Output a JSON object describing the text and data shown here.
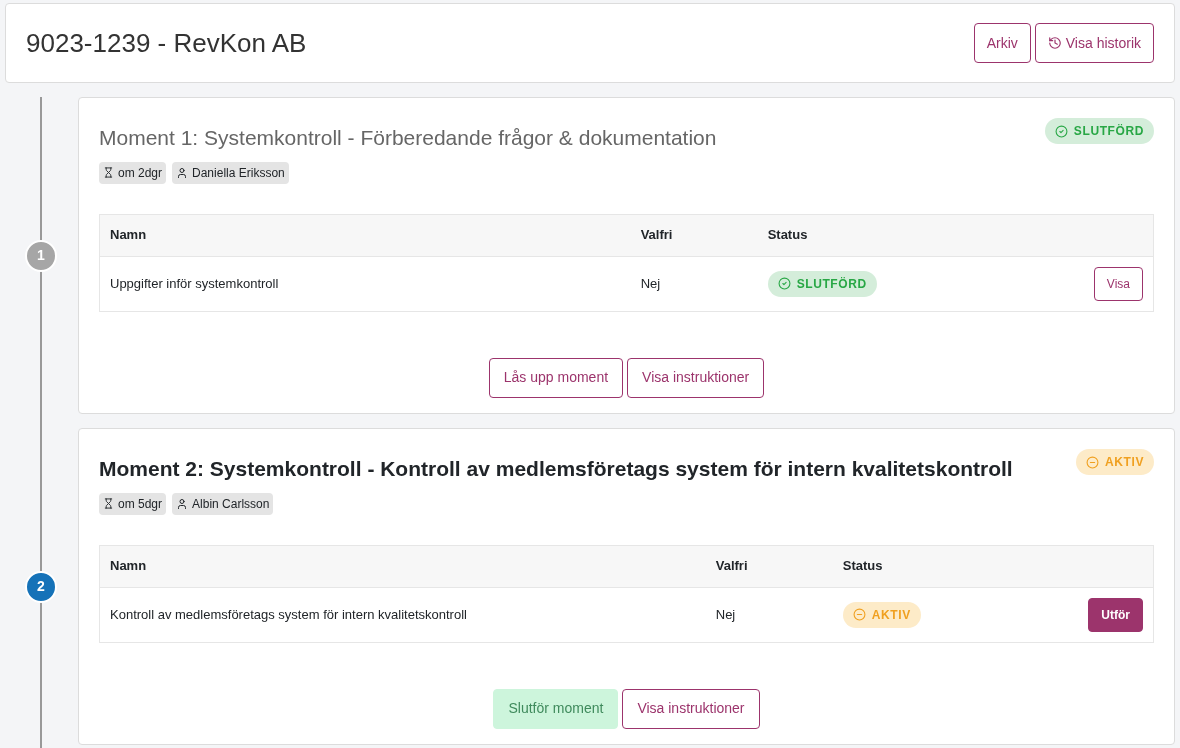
{
  "header": {
    "title": "9023-1239 - RevKon AB",
    "buttons": [
      {
        "label": "Arkiv",
        "kind": "plain"
      },
      {
        "label": "Visa historik",
        "kind": "history"
      }
    ]
  },
  "moments": [
    {
      "step": "1",
      "active": false,
      "title": "Moment 1: Systemkontroll - Förberedande frågor & dokumentation",
      "status": {
        "kind": "done",
        "label": "SLUTFÖRD"
      },
      "due": "om 2dgr",
      "assignee": "Daniella Eriksson",
      "columns": [
        "Namn",
        "Valfri",
        "Status"
      ],
      "rows": [
        {
          "name": "Uppgifter inför systemkontroll",
          "optional": "Nej",
          "status": {
            "kind": "done",
            "label": "SLUTFÖRD"
          },
          "action": {
            "kind": "outline",
            "label": "Visa"
          }
        }
      ],
      "buttons": [
        {
          "kind": "outline",
          "label": "Lås upp moment"
        },
        {
          "kind": "outline",
          "label": "Visa instruktioner"
        }
      ]
    },
    {
      "step": "2",
      "active": true,
      "title": "Moment 2: Systemkontroll - Kontroll av medlemsföretags system för intern kvalitetskontroll",
      "status": {
        "kind": "active",
        "label": "AKTIV"
      },
      "due": "om 5dgr",
      "assignee": "Albin Carlsson",
      "columns": [
        "Namn",
        "Valfri",
        "Status"
      ],
      "rows": [
        {
          "name": "Kontroll av medlemsföretags system för intern kvalitetskontroll",
          "optional": "Nej",
          "status": {
            "kind": "active",
            "label": "AKTIV"
          },
          "action": {
            "kind": "filled",
            "label": "Utför"
          }
        }
      ],
      "buttons": [
        {
          "kind": "disabled",
          "label": "Slutför moment"
        },
        {
          "kind": "outline",
          "label": "Visa instruktioner"
        }
      ]
    }
  ]
}
